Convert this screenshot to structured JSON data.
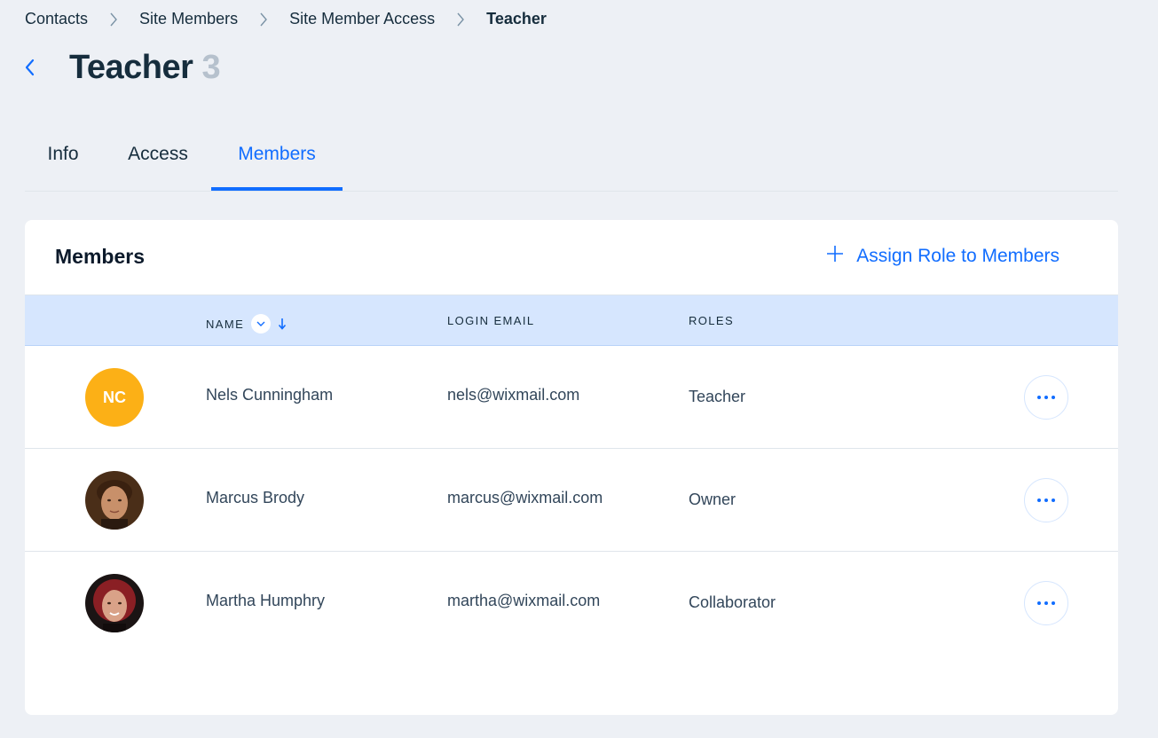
{
  "breadcrumb": {
    "items": [
      "Contacts",
      "Site Members",
      "Site Member Access",
      "Teacher"
    ]
  },
  "header": {
    "title": "Teacher",
    "count": "3"
  },
  "tabs": [
    {
      "label": "Info",
      "active": false
    },
    {
      "label": "Access",
      "active": false
    },
    {
      "label": "Members",
      "active": true
    }
  ],
  "members_card": {
    "title": "Members",
    "assign_label": "Assign Role to Members",
    "columns": {
      "name": "NAME",
      "email": "LOGIN EMAIL",
      "roles": "ROLES"
    },
    "rows": [
      {
        "initials": "NC",
        "name": "Nels Cunningham",
        "email": "nels@wixmail.com",
        "role": "Teacher",
        "avatar": "initials"
      },
      {
        "initials": "",
        "name": "Marcus Brody",
        "email": "marcus@wixmail.com",
        "role": "Owner",
        "avatar": "photo"
      },
      {
        "initials": "",
        "name": "Martha Humphry",
        "email": "martha@wixmail.com",
        "role": "Collaborator",
        "avatar": "photo"
      }
    ]
  },
  "colors": {
    "accent": "#116dff",
    "page_bg": "#edf0f5",
    "header_row_bg": "#d6e6fe",
    "initials_avatar": "#fcb016"
  },
  "icons": {
    "back": "chevron-left-icon",
    "separator": "chevron-right-icon",
    "assign": "plus-icon",
    "sort_toggle": "chevron-down-icon",
    "sort_direction": "arrow-down-icon",
    "row_actions": "more-horizontal-icon"
  }
}
